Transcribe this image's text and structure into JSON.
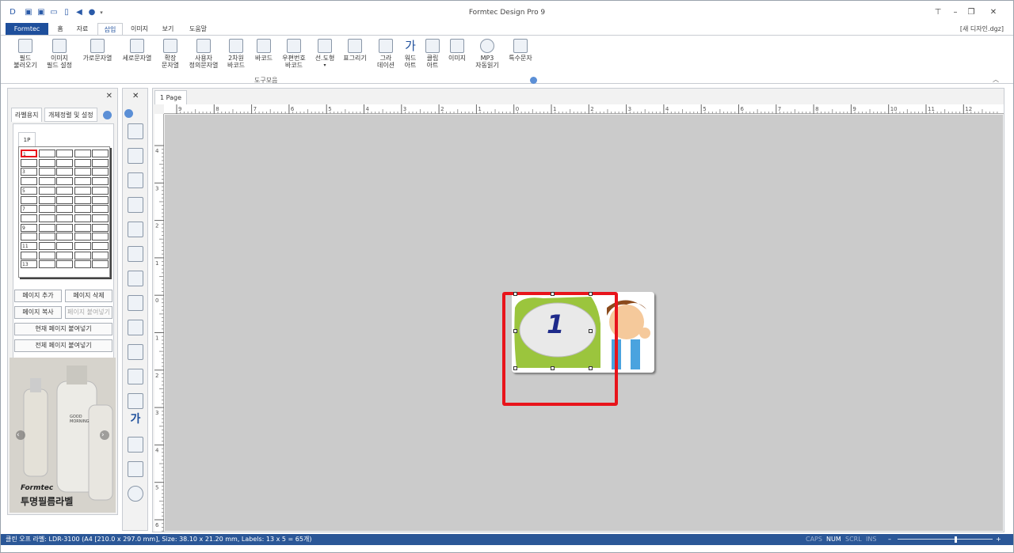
{
  "app": {
    "title": "Formtec Design Pro 9",
    "doc_name": "[새 디자인.dgz]"
  },
  "tabs": [
    "Formtec",
    "홈",
    "자료",
    "삽입",
    "이미지",
    "보기",
    "도움말"
  ],
  "ribbon": {
    "buttons": [
      {
        "label": "필드\n불러오기"
      },
      {
        "label": "이미지\n필드 설정"
      },
      {
        "label": "가로문자열"
      },
      {
        "label": "세로문자열"
      },
      {
        "label": "확장\n문자열"
      },
      {
        "label": "사용자\n정의문자열"
      },
      {
        "label": "2차원\n바코드"
      },
      {
        "label": "바코드"
      },
      {
        "label": "우편번호\n바코드"
      },
      {
        "label": "선.도형"
      },
      {
        "label": "표그리기"
      },
      {
        "label": "그라\n데이션"
      },
      {
        "label": "워드\n아트"
      },
      {
        "label": "클립\n아트"
      },
      {
        "label": "이미지"
      },
      {
        "label": "MP3\n자동읽기"
      },
      {
        "label": "특수문자"
      }
    ],
    "group_name": "도구모음"
  },
  "left_panel": {
    "tabs": [
      "라벨용지",
      "개체정렬 및 설정"
    ],
    "page_tab": "1P",
    "row_labels": [
      "1",
      "3",
      "5",
      "7",
      "9",
      "11",
      "13"
    ],
    "buttons": {
      "add_page": "페이지 추가",
      "delete_page": "페이지 삭제",
      "copy_page": "페이지 복사",
      "paste_page": "페이지 붙여넣기",
      "paste_current": "현재 페이지 붙여넣기",
      "paste_all": "전체 페이지 붙여넣기"
    },
    "promo": {
      "brand": "Formtec",
      "caption": "투명필름라벨",
      "bottle_text": "GOOD\nMORNING"
    }
  },
  "canvas": {
    "page_tab": "1 Page",
    "h_ruler_labels": [
      "9",
      "8",
      "7",
      "6",
      "5",
      "4",
      "3",
      "2",
      "1",
      "0",
      "1",
      "2",
      "3",
      "4",
      "5",
      "6",
      "7",
      "8",
      "9",
      "10",
      "11",
      "12"
    ],
    "v_ruler_labels": [
      "4",
      "3",
      "2",
      "1",
      "0",
      "1",
      "2",
      "3",
      "4",
      "5",
      "6"
    ],
    "bubble_number": "1"
  },
  "status": {
    "text": "클린 오프 라벨: LDR-3100 (A4 [210.0 x 297.0 mm], Size: 38.10 x 21.20 mm,  Labels: 13 x 5 = 65개)",
    "flags": [
      "CAPS",
      "NUM",
      "SCRL",
      "INS"
    ]
  },
  "colors": {
    "accent": "#1e4f9c",
    "selection": "#e8141b",
    "status_bar": "#2b5797",
    "canvas": "#cbcbcb"
  }
}
